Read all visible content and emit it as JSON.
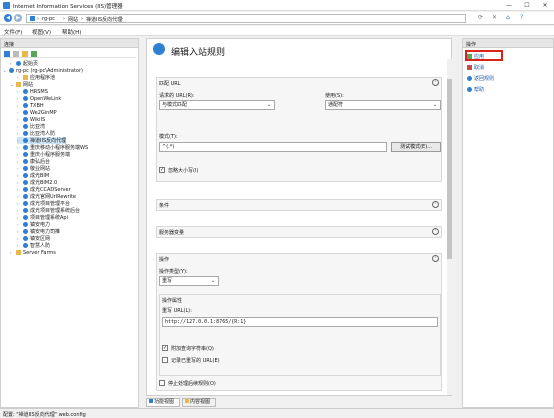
{
  "window": {
    "title": "Internet Information Services (IIS)管理器",
    "min": "—",
    "max": "☐",
    "close": "✕"
  },
  "address": {
    "path": [
      "rg-pc",
      "网站",
      "禅道IIS反向代理"
    ]
  },
  "menu": [
    "文件(F)",
    "视图(V)",
    "帮助(H)"
  ],
  "left_pane": {
    "header": "连接",
    "tree": [
      {
        "label": "起始页",
        "level": 1,
        "icon": "start"
      },
      {
        "label": "rg-pc (rg-pc\\Administrator)",
        "level": 0,
        "icon": "server",
        "expanded": true
      },
      {
        "label": "应用程序池",
        "level": 2,
        "icon": "pool"
      },
      {
        "label": "网站",
        "level": 1,
        "icon": "folder",
        "expanded": true
      },
      {
        "label": "HRSMS",
        "level": 2,
        "icon": "site"
      },
      {
        "label": "OpenWeLink",
        "level": 2,
        "icon": "site"
      },
      {
        "label": "TXBH",
        "level": 2,
        "icon": "site"
      },
      {
        "label": "We2GinMP",
        "level": 2,
        "icon": "site"
      },
      {
        "label": "WikiIS",
        "level": 2,
        "icon": "site"
      },
      {
        "label": "比亚湾",
        "level": 2,
        "icon": "site"
      },
      {
        "label": "比亚湾人防",
        "level": 2,
        "icon": "site"
      },
      {
        "label": "禅道IIS反向代理",
        "level": 2,
        "icon": "site",
        "selected": true
      },
      {
        "label": "重庆移动小程序服务端WS",
        "level": 2,
        "icon": "site"
      },
      {
        "label": "重庆小程序服务端",
        "level": 2,
        "icon": "site"
      },
      {
        "label": "康弘后台",
        "level": 2,
        "icon": "site"
      },
      {
        "label": "敬业网站",
        "level": 2,
        "icon": "site"
      },
      {
        "label": "成光BIM",
        "level": 2,
        "icon": "site"
      },
      {
        "label": "成光BIM2.0",
        "level": 2,
        "icon": "site"
      },
      {
        "label": "成光CCADServer",
        "level": 2,
        "icon": "site"
      },
      {
        "label": "成光官网UrlRewrite",
        "level": 2,
        "icon": "site"
      },
      {
        "label": "成光项目管理平台",
        "level": 2,
        "icon": "site"
      },
      {
        "label": "成光项目管理系统后台",
        "level": 2,
        "icon": "site"
      },
      {
        "label": "项目管理系统Api",
        "level": 2,
        "icon": "site"
      },
      {
        "label": "镇安电力",
        "level": 2,
        "icon": "site"
      },
      {
        "label": "镇安电力司推",
        "level": 2,
        "icon": "site"
      },
      {
        "label": "镇安区网",
        "level": 2,
        "icon": "site"
      },
      {
        "label": "智慧人防",
        "level": 2,
        "icon": "site"
      },
      {
        "label": "Server Farms",
        "level": 1,
        "icon": "farm"
      }
    ]
  },
  "center": {
    "title": "编辑入站规则",
    "match_url": {
      "title": "匹配 URL",
      "request_url_label": "请求的 URL(R):",
      "request_url_value": "与模式匹配",
      "using_label": "使用(S):",
      "using_value": "通配符",
      "pattern_label": "模式(T):",
      "pattern_value": "^(.*)",
      "test_button": "测试模式(E)...",
      "ignore_case": "忽略大小写(I)"
    },
    "conditions": {
      "title": "条件"
    },
    "server_variables": {
      "title": "服务器变量"
    },
    "action": {
      "title": "操作",
      "type_label": "操作类型(Y):",
      "type_value": "重写",
      "props_title": "操作属性",
      "rewrite_url_label": "重写 URL(L):",
      "rewrite_url_value": "http://127.0.0.1:8765/{R:1}",
      "append_query": "附加查询字符串(Q)",
      "log_rewritten": "记录已重写的 URL(E)",
      "stop_processing": "停止处理后续规则(O)"
    },
    "tabs": [
      "功能视图",
      "内容视图"
    ]
  },
  "right_pane": {
    "header": "操作",
    "actions": [
      {
        "label": "应用",
        "icon": "apply-icon"
      },
      {
        "label": "取消",
        "icon": "cancel-icon"
      },
      {
        "label": "返回规则",
        "icon": "back-icon"
      },
      {
        "label": "帮助",
        "icon": "help-icon"
      }
    ]
  },
  "status_bar": "配置: \"禅道IIS反向代理\" web.config",
  "colors": {
    "accent": "#1a5aa8",
    "selection": "#cde5f7",
    "highlight_box": "#d9231b"
  }
}
